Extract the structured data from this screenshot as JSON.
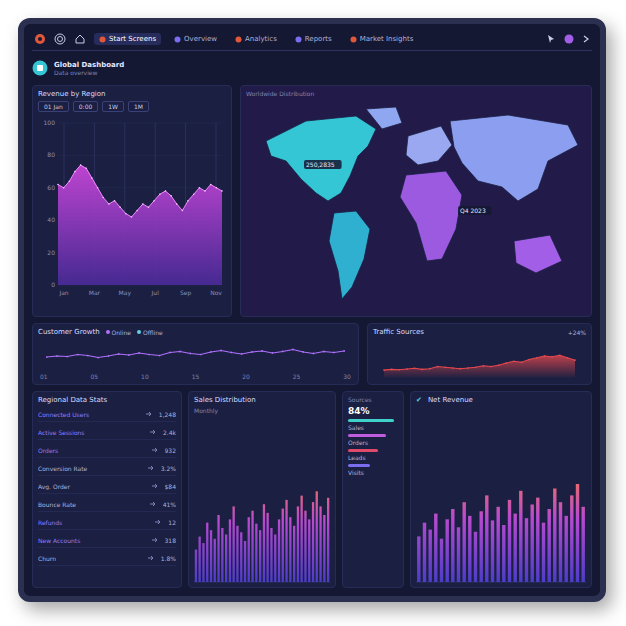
{
  "nav": {
    "items": [
      {
        "label": "Start Screens",
        "selected": true
      },
      {
        "label": "Overview",
        "selected": false
      },
      {
        "label": "Analytics",
        "selected": false
      },
      {
        "label": "Reports",
        "selected": false
      },
      {
        "label": "Market Insights",
        "selected": false
      }
    ]
  },
  "header": {
    "title": "Global Dashboard",
    "subtitle": "Data overview"
  },
  "area_chart": {
    "title": "Revenue by Region",
    "controls": [
      "01 Jan",
      "0:00",
      "1W",
      "1M"
    ],
    "y_ticks": [
      "100",
      "80",
      "60",
      "40",
      "20",
      "0"
    ],
    "x_ticks": [
      "Jan",
      "Mar",
      "May",
      "Jul",
      "Sep",
      "Nov"
    ],
    "values": [
      62,
      60,
      64,
      70,
      74,
      72,
      66,
      60,
      54,
      50,
      52,
      48,
      44,
      42,
      46,
      50,
      48,
      52,
      56,
      58,
      55,
      50,
      46,
      52,
      56,
      60,
      58,
      62,
      60,
      58
    ]
  },
  "map": {
    "title": "Worldwide Distribution",
    "regions": [
      {
        "name": "North America",
        "color": "#35c6d6"
      },
      {
        "name": "Greenland",
        "color": "#8fa6f0"
      },
      {
        "name": "South America",
        "color": "#2fb0d0"
      },
      {
        "name": "Europe",
        "color": "#9aa8f2"
      },
      {
        "name": "Africa",
        "color": "#9b5ae0"
      },
      {
        "name": "Asia",
        "color": "#8c9ef0"
      },
      {
        "name": "Australia",
        "color": "#a35ee8"
      }
    ],
    "labels": [
      "250,2835",
      "Q4 2023"
    ]
  },
  "line_chart": {
    "title": "Customer Growth",
    "legend": [
      {
        "label": "Online",
        "color": "#b070ff"
      },
      {
        "label": "Offline",
        "color": "#5fd0e0"
      }
    ],
    "values": [
      40,
      44,
      42,
      50,
      46,
      38,
      44,
      52,
      48,
      56,
      50,
      46,
      58,
      62,
      54,
      50,
      60,
      66,
      58,
      52,
      60,
      64,
      56,
      62,
      70,
      60,
      54,
      62,
      58,
      64
    ],
    "x_ticks": [
      "01",
      "05",
      "10",
      "15",
      "20",
      "25",
      "30"
    ]
  },
  "traffic_chart": {
    "title": "Traffic Sources",
    "reading": "+24%",
    "values": [
      20,
      22,
      21,
      23,
      25,
      22,
      24,
      30,
      28,
      26,
      24,
      26,
      28,
      32,
      30,
      34,
      40,
      45,
      42,
      50,
      55,
      60,
      58,
      62,
      55,
      48
    ]
  },
  "list": {
    "title": "Regional Data Stats",
    "rows": [
      {
        "label": "Connected Users",
        "value": "1,248",
        "color": "#8f7cff"
      },
      {
        "label": "Active Sessions",
        "value": "2.4k",
        "color": "#8f7cff"
      },
      {
        "label": "Orders",
        "value": "932",
        "color": "#8f7cff"
      },
      {
        "label": "Conversion Rate",
        "value": "3.2%",
        "color": "#aeb2da"
      },
      {
        "label": "Avg. Order",
        "value": "$84",
        "color": "#aeb2da"
      },
      {
        "label": "Bounce Rate",
        "value": "41%",
        "color": "#aeb2da"
      },
      {
        "label": "Refunds",
        "value": "12",
        "color": "#8f7cff"
      },
      {
        "label": "New Accounts",
        "value": "318",
        "color": "#8f7cff"
      },
      {
        "label": "Churn",
        "value": "1.8%",
        "color": "#aeb2da"
      }
    ]
  },
  "bar_chart_1": {
    "title": "Sales Distribution",
    "subtitle": "Monthly",
    "values": [
      30,
      42,
      36,
      55,
      48,
      40,
      62,
      50,
      44,
      58,
      70,
      52,
      46,
      38,
      60,
      66,
      54,
      48,
      72,
      64,
      50,
      44,
      58,
      68,
      76,
      60,
      52,
      70,
      80,
      66,
      58,
      74,
      84,
      70,
      62,
      78
    ]
  },
  "legend_panel": {
    "title": "Sources",
    "reading": "84%",
    "items": [
      {
        "label": "Sales",
        "color": "#3fd0c9"
      },
      {
        "label": "Orders",
        "color": "#c05ce0"
      },
      {
        "label": "Leads",
        "color": "#e04a6a"
      },
      {
        "label": "Visits",
        "color": "#7b6cf0"
      }
    ]
  },
  "bar_chart_2": {
    "icon": "✔",
    "title": "Net Revenue",
    "values": [
      40,
      52,
      46,
      60,
      38,
      55,
      64,
      48,
      70,
      58,
      44,
      62,
      76,
      54,
      66,
      50,
      72,
      60,
      80,
      56,
      68,
      74,
      52,
      64,
      82,
      70,
      58,
      76,
      86,
      66
    ]
  }
}
